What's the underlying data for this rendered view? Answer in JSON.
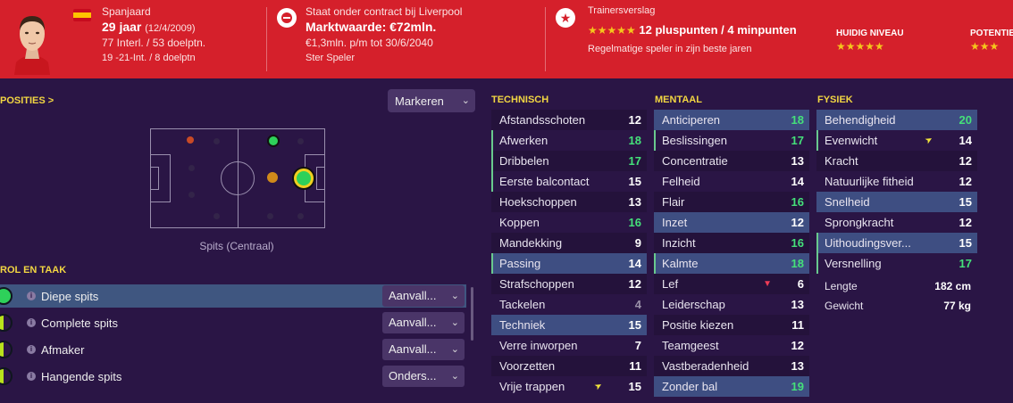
{
  "header": {
    "nationality": "Spanjaard",
    "age": "29 jaar",
    "dob": "(12/4/2009)",
    "caps": "77 Interl. / 53 doelptn.",
    "u21": "19 -21-Int. / 8 doelptn",
    "contract": "Staat onder contract bij Liverpool",
    "value": "Marktwaarde: €72mln.",
    "wage": "€1,3mln. p/m tot 30/6/2040",
    "status": "Ster Speler",
    "report_title": "Trainersverslag",
    "report_stars": "★★★★★",
    "report_points": "12 pluspunten / 4 minpunten",
    "report_note": "Regelmatige speler in zijn beste jaren",
    "current_level_label": "HUIDIG NIVEAU",
    "current_level_stars": "★★★★★",
    "potential_label": "POTENTIE",
    "potential_stars": "★★★"
  },
  "positions": {
    "title": "POSITIES >",
    "dropdown": "Markeren",
    "pitch_label": "Spits (Centraal)"
  },
  "roles": {
    "title": "ROL EN TAAK",
    "items": [
      {
        "name": "Diepe spits",
        "duty": "Aanvall..."
      },
      {
        "name": "Complete spits",
        "duty": "Aanvall..."
      },
      {
        "name": "Afmaker",
        "duty": "Aanvall..."
      },
      {
        "name": "Hangende spits",
        "duty": "Onders..."
      }
    ]
  },
  "attributes": {
    "technical": {
      "title": "TECHNISCH",
      "rows": [
        {
          "name": "Afstandsschoten",
          "value": "12"
        },
        {
          "name": "Afwerken",
          "value": "18"
        },
        {
          "name": "Dribbelen",
          "value": "17"
        },
        {
          "name": "Eerste balcontact",
          "value": "15"
        },
        {
          "name": "Hoekschoppen",
          "value": "13"
        },
        {
          "name": "Koppen",
          "value": "16"
        },
        {
          "name": "Mandekking",
          "value": "9"
        },
        {
          "name": "Passing",
          "value": "14"
        },
        {
          "name": "Strafschoppen",
          "value": "12"
        },
        {
          "name": "Tackelen",
          "value": "4"
        },
        {
          "name": "Techniek",
          "value": "15"
        },
        {
          "name": "Verre inworpen",
          "value": "7"
        },
        {
          "name": "Voorzetten",
          "value": "11"
        },
        {
          "name": "Vrije trappen",
          "value": "15"
        }
      ]
    },
    "mental": {
      "title": "MENTAAL",
      "rows": [
        {
          "name": "Anticiperen",
          "value": "18"
        },
        {
          "name": "Beslissingen",
          "value": "17"
        },
        {
          "name": "Concentratie",
          "value": "13"
        },
        {
          "name": "Felheid",
          "value": "14"
        },
        {
          "name": "Flair",
          "value": "16"
        },
        {
          "name": "Inzet",
          "value": "12"
        },
        {
          "name": "Inzicht",
          "value": "16"
        },
        {
          "name": "Kalmte",
          "value": "18"
        },
        {
          "name": "Lef",
          "value": "6"
        },
        {
          "name": "Leiderschap",
          "value": "13"
        },
        {
          "name": "Positie kiezen",
          "value": "11"
        },
        {
          "name": "Teamgeest",
          "value": "12"
        },
        {
          "name": "Vastberadenheid",
          "value": "13"
        },
        {
          "name": "Zonder bal",
          "value": "19"
        }
      ]
    },
    "physical": {
      "title": "FYSIEK",
      "rows": [
        {
          "name": "Behendigheid",
          "value": "20"
        },
        {
          "name": "Evenwicht",
          "value": "14"
        },
        {
          "name": "Kracht",
          "value": "12"
        },
        {
          "name": "Natuurlijke fitheid",
          "value": "12"
        },
        {
          "name": "Snelheid",
          "value": "15"
        },
        {
          "name": "Sprongkracht",
          "value": "12"
        },
        {
          "name": "Uithoudingsver...",
          "value": "15"
        },
        {
          "name": "Versnelling",
          "value": "17"
        }
      ],
      "height_label": "Lengte",
      "height_value": "182 cm",
      "weight_label": "Gewicht",
      "weight_value": "77 kg"
    }
  },
  "colors": {
    "header_red": "#d5202b",
    "background": "#2a1545",
    "accent_yellow": "#f2d642",
    "value_green": "#45e07a",
    "value_yellow": "#f3e53b",
    "value_white": "#ffffff",
    "value_grey": "#9a90a8"
  }
}
